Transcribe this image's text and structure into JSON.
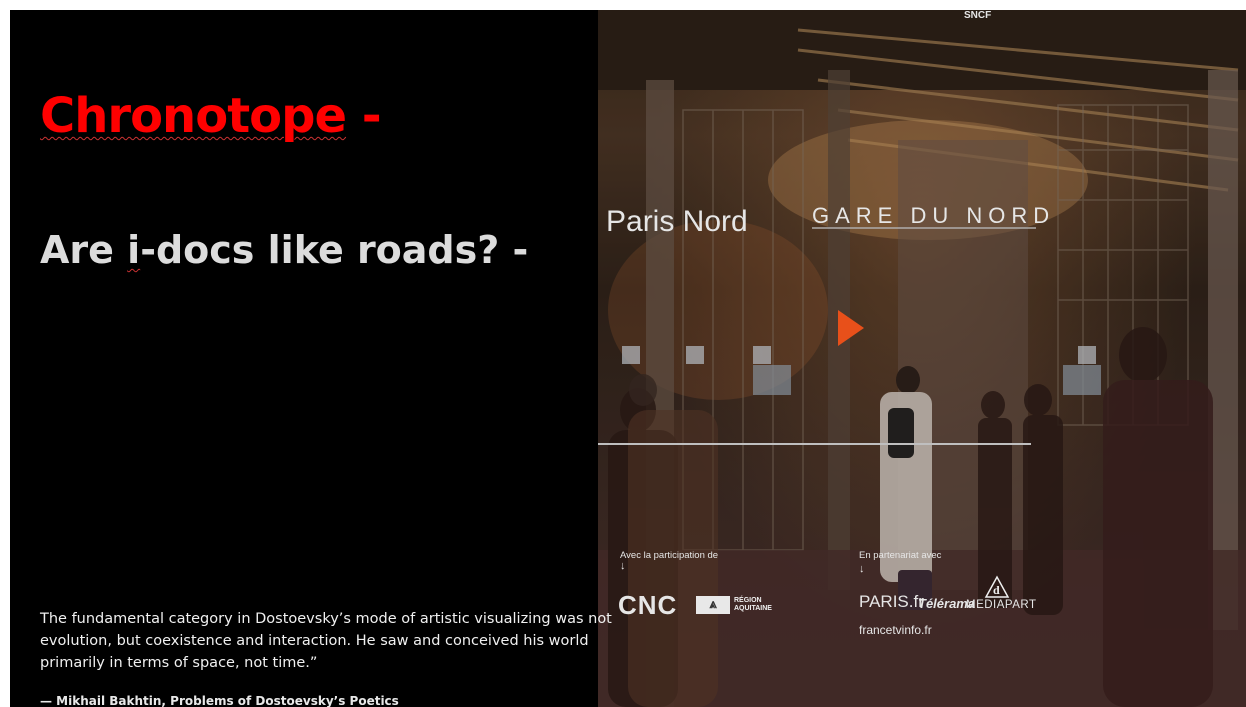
{
  "slide": {
    "title": "Chronotope",
    "title_suffix": " -",
    "subtitle_pre": "Are ",
    "subtitle_flagged": "i",
    "subtitle_post": "-docs like roads? -",
    "quote": "The fundamental category in Dostoevsky’s mode of artistic visualizing was not evolution, but coexistence and interaction. He saw and conceived his world primarily in terms of space, not time.”",
    "attribution": "— Mikhail Bakhtin, Problems of Dostoevsky’s Poetics"
  },
  "video": {
    "station_sign": "GARE DU NORD",
    "station_sign_faded": "Paris Nord",
    "sncf": "SNCF",
    "participation_label": "Avec la participation de",
    "partnership_label": "En partenariat avec",
    "arrow": "↓",
    "sponsor_cnc": "CNC",
    "sponsor_region_line1": "RÉGION",
    "sponsor_region_line2": "AQUITAINE",
    "partner_paris": "PARIS.fr",
    "partner_telerama": "Télérama",
    "partner_mediapart": "MEDIAPART",
    "partner_francetv": "francetvinfo.fr"
  },
  "colors": {
    "title": "#ff0000",
    "subtitle": "#dcdcdc",
    "background": "#000000",
    "play_button": "#e8501a"
  },
  "icons": {
    "play": "play-icon",
    "region_logo": "region-aquitaine-logo",
    "mediapart_logo": "mediapart-logo"
  }
}
